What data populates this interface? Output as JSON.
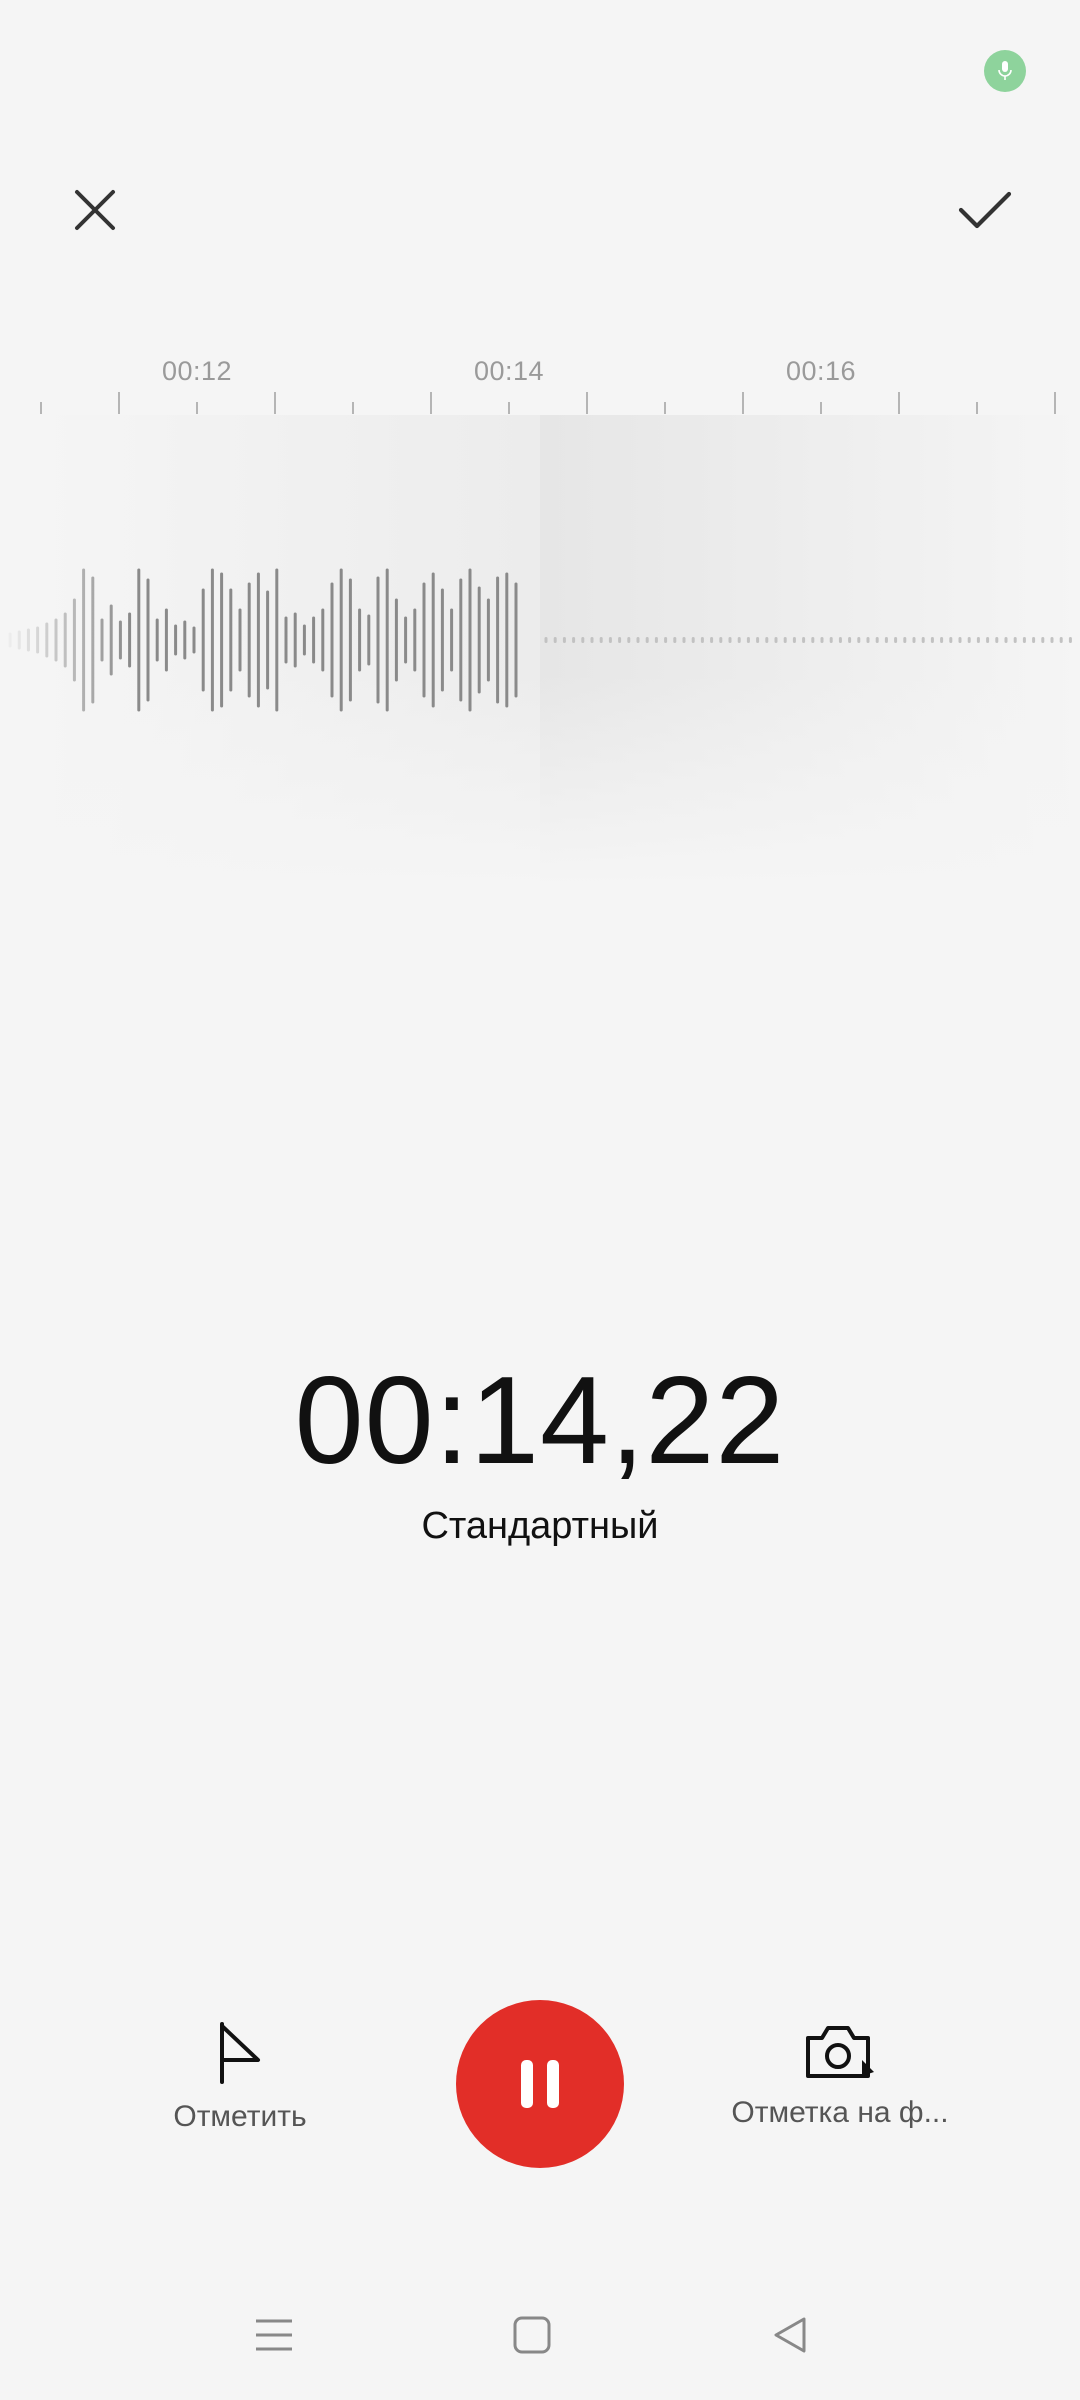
{
  "status_bar": {
    "mic_icon": "mic-icon",
    "indicator_color": "#8ed39c"
  },
  "header": {
    "close_icon": "close-icon",
    "confirm_icon": "check-icon"
  },
  "timeline": {
    "tick_labels": [
      "00:12",
      "00:14",
      "00:16"
    ],
    "playhead_color": "#e53935"
  },
  "recording": {
    "elapsed_time": "00:14,22",
    "mode": "Стандартный"
  },
  "controls": {
    "mark_label": "Отметить",
    "mark_icon": "flag-icon",
    "pause_icon": "pause-icon",
    "pause_color": "#e22e28",
    "photo_mark_label": "Отметка на ф...",
    "photo_mark_icon": "camera-icon"
  },
  "navigation": {
    "menu_icon": "menu-icon",
    "home_icon": "home-icon",
    "back_icon": "back-icon"
  }
}
